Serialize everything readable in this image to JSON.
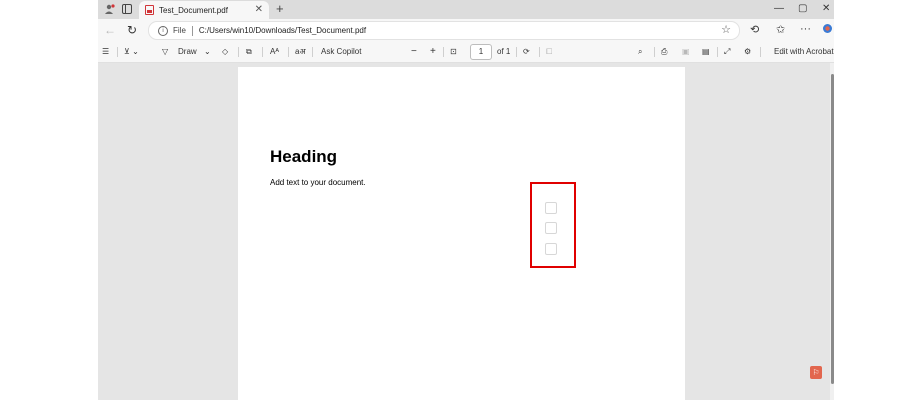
{
  "tab": {
    "title": "Test_Document.pdf"
  },
  "address_bar": {
    "scheme_label": "File",
    "url": "C:/Users/win10/Downloads/Test_Document.pdf"
  },
  "pdf_toolbar": {
    "draw_label": "Draw",
    "read_aloud_label": "Aᴬ",
    "translate_label": "aअ",
    "ask_copilot_label": "Ask Copilot",
    "zoom_out_label": "−",
    "zoom_in_label": "+",
    "current_page": "1",
    "page_total_label": "of 1",
    "edit_acrobat_label": "Edit with Acrobat"
  },
  "document": {
    "heading": "Heading",
    "body": "Add text to your document."
  },
  "colors": {
    "highlight_border": "#e00000",
    "acrobat_accent": "#e2664e"
  },
  "icons": {
    "window": [
      "profile-icon",
      "sidebar-icon",
      "pdf-icon",
      "close-icon",
      "new-tab-icon",
      "minimize-icon",
      "restore-icon",
      "window-close-icon"
    ],
    "address": [
      "back-icon",
      "refresh-icon",
      "info-icon",
      "star-icon",
      "browser-essentials-icon",
      "favorites-icon",
      "more-icon",
      "copilot-icon"
    ],
    "toolbar": [
      "contents-icon",
      "highlight-icon",
      "draw-icon",
      "eraser-icon",
      "page-view-icon",
      "fit-page-icon",
      "rotate-icon",
      "two-page-icon",
      "search-icon",
      "print-icon",
      "save-icon",
      "save-as-icon",
      "fullscreen-icon",
      "settings-icon"
    ]
  }
}
